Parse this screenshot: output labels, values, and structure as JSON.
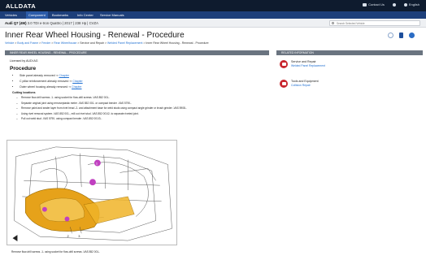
{
  "app": {
    "logo": "ALLDATA"
  },
  "topbar": {
    "contact": "Contact Us",
    "language": "English"
  },
  "nav": {
    "items": [
      {
        "label": "Vehicles"
      },
      {
        "label": "Component"
      },
      {
        "label": "Bookmarks"
      },
      {
        "label": "Info Center"
      },
      {
        "label": "Service Manuals"
      }
    ]
  },
  "vehicle": {
    "name": "Audi Q7 (4M)",
    "detail": "3.0 TDI e-tron Quattro | 2017 | 238 Hp | CVZA"
  },
  "search": {
    "placeholder": "Search Selected Vehicle"
  },
  "page": {
    "title": "Inner Rear Wheel Housing - Renewal - Procedure"
  },
  "breadcrumb": [
    {
      "label": "Vehicle",
      "link": true
    },
    {
      "label": "Body and Frame",
      "link": true
    },
    {
      "label": "Fender",
      "link": true
    },
    {
      "label": "Rear Wheelhouse",
      "link": true
    },
    {
      "label": "Service and Repair",
      "link": false
    },
    {
      "label": "Welded Panel Replacement",
      "link": true
    },
    {
      "label": "Inner Rear Wheel Housing - Renewal - Procedure",
      "link": false
    }
  ],
  "doc": {
    "header": "INNER REAR WHEEL HOUSING - RENEWAL - PROCEDURE",
    "licensed": "Licensed by AUDI AG",
    "procedure_title": "Procedure",
    "bullets": [
      {
        "text": "Side panel already removed",
        "link": "Chapter"
      },
      {
        "text": "C pillar reinforcement already removed",
        "link": "Chapter"
      },
      {
        "text": "Outer wheel housing already removed",
        "link": "Chapter"
      }
    ],
    "cutting_title": "Cutting locations",
    "cutting": [
      "Remove flow-drill screws -1- using socket for flow-drill screws -VAS 852 001-.",
      "Separate original joint using removeplastic meter -VAS 852 001- or compact bender -VAS 5790-.",
      "Remove paint and sealer layer from rivet head -2- and attachment base for weld studs using compact angle grinder or brush grinder -VAS 5908-.",
      "Using rivet removal system -VAS 852 001-, mill out rivet stud -VAS 852 001/2- to separate riveted joint.",
      "Pull out weld stud -VAS 5790- using compact bender -VAS 852 001/3-."
    ],
    "caption": "Remove flow-drill screws -1- using socket for flow-drill screws -VAS 852 001-."
  },
  "sidebar": {
    "header": "RELATED INFORMATION",
    "items": [
      {
        "title": "Service and Repair",
        "link": "Welded Panel Replacement"
      },
      {
        "title": "Tools and Equipment",
        "link": "Collision Repair"
      }
    ]
  },
  "figure": {
    "callouts": [
      "1",
      "2",
      "3"
    ]
  }
}
